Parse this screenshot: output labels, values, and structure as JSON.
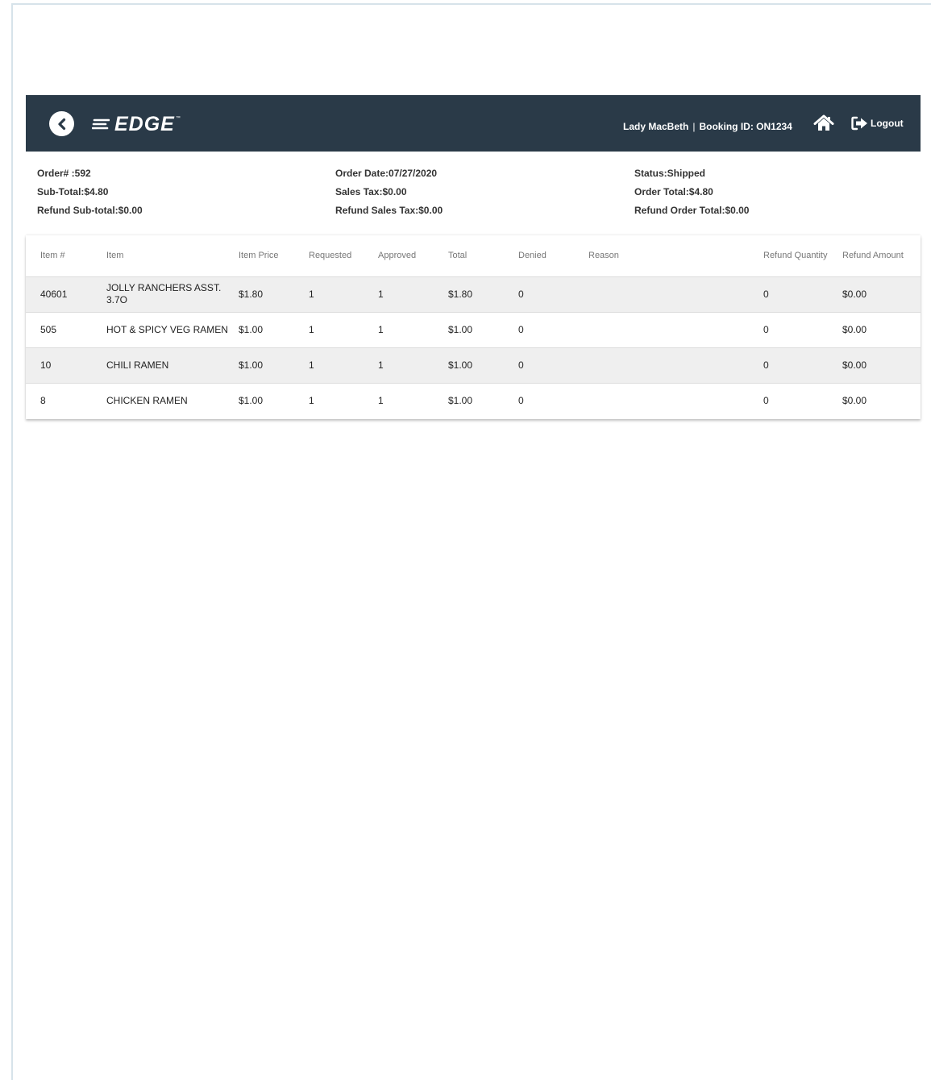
{
  "header": {
    "logo_text": "EDGE",
    "logo_tm": "™",
    "user_name": "Lady MacBeth",
    "separator": "|",
    "booking_id": "Booking ID: ON1234",
    "logout_label": "Logout",
    "home_icon": "home-icon",
    "logout_icon": "logout-icon",
    "back_icon": "back-circle-icon"
  },
  "summary": {
    "order_no": "Order# :592",
    "sub_total": "Sub-Total:$4.80",
    "refund_sub_total": "Refund Sub-total:$0.00",
    "order_date": "Order Date:07/27/2020",
    "sales_tax": "Sales Tax:$0.00",
    "refund_sales_tax": "Refund Sales Tax:$0.00",
    "status": "Status:Shipped",
    "order_total": "Order Total:$4.80",
    "refund_order_total": "Refund Order Total:$0.00"
  },
  "table": {
    "columns": [
      "Item #",
      "Item",
      "Item Price",
      "Requested",
      "Approved",
      "Total",
      "Denied",
      "Reason",
      "Refund Quantity",
      "Refund Amount"
    ],
    "rows": [
      [
        "40601",
        "JOLLY RANCHERS ASST. 3.7O",
        "$1.80",
        "1",
        "1",
        "$1.80",
        "0",
        "",
        "0",
        "$0.00"
      ],
      [
        "505",
        "HOT & SPICY VEG RAMEN",
        "$1.00",
        "1",
        "1",
        "$1.00",
        "0",
        "",
        "0",
        "$0.00"
      ],
      [
        "10",
        "CHILI RAMEN",
        "$1.00",
        "1",
        "1",
        "$1.00",
        "0",
        "",
        "0",
        "$0.00"
      ],
      [
        "8",
        "CHICKEN RAMEN",
        "$1.00",
        "1",
        "1",
        "$1.00",
        "0",
        "",
        "0",
        "$0.00"
      ]
    ]
  },
  "colors": {
    "navbar": "#2a3a48",
    "row_alt": "#efefef"
  }
}
